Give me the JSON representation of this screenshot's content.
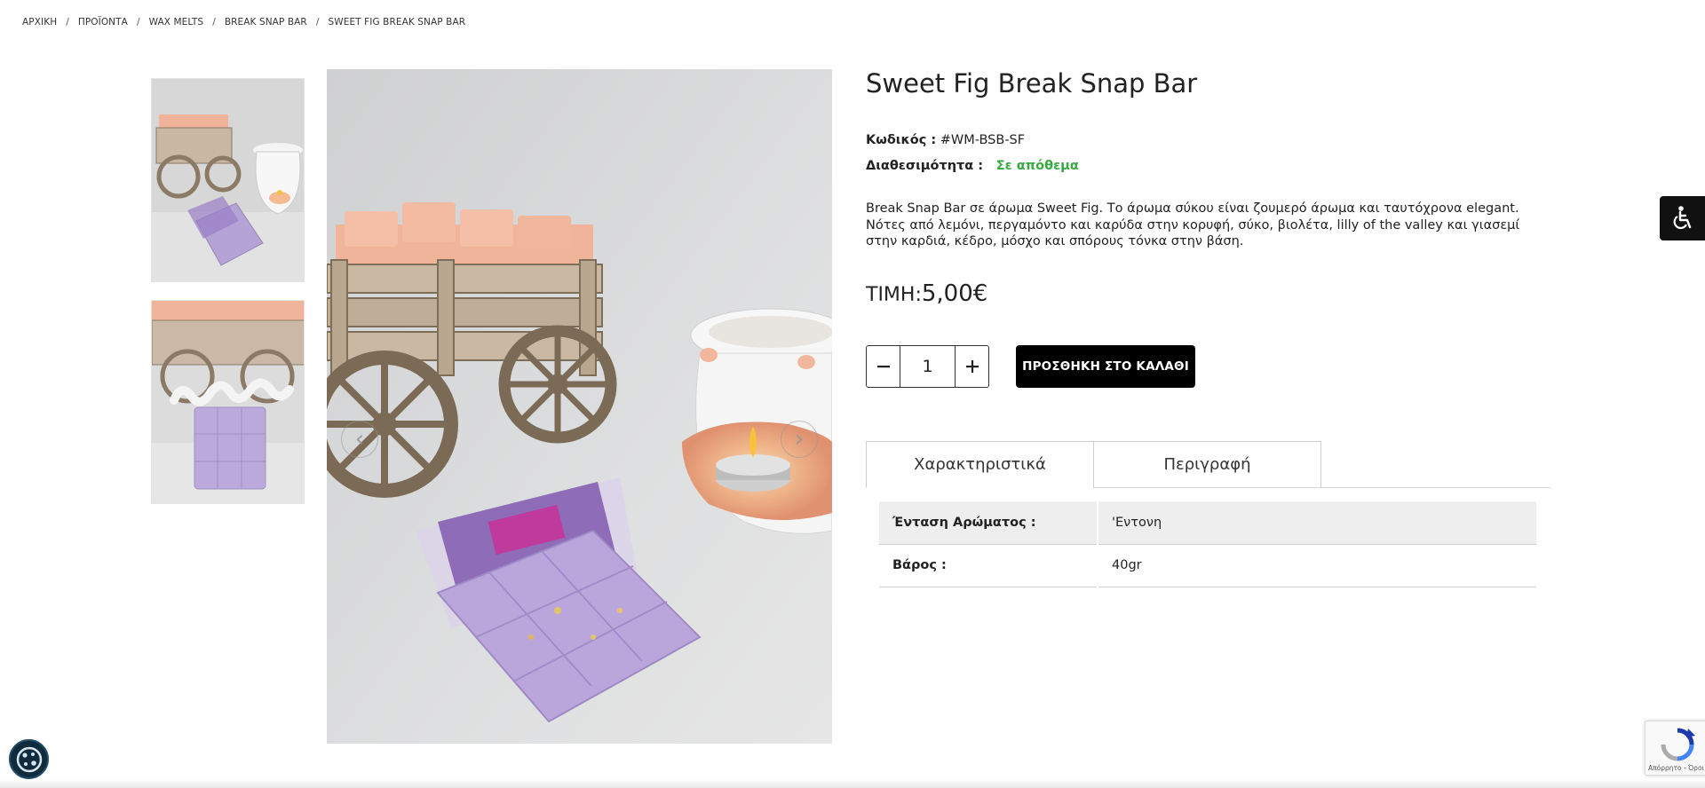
{
  "breadcrumb": {
    "items": [
      "ΑΡΧΙΚΗ",
      "ΠΡΟΪΟΝΤΑ",
      "WAX MELTS",
      "BREAK SNAP BAR",
      "SWEET FIG BREAK SNAP BAR"
    ],
    "separator": "/"
  },
  "product": {
    "title": "Sweet Fig Break Snap Bar",
    "code_label": "Κωδικός :",
    "code_value": "#WM-BSB-SF",
    "availability_label": "Διαθεσιμότητα :",
    "availability_value": "Σε απόθεμα",
    "description": "Break Snap Bar σε άρωμα Sweet Fig. Το άρωμα σύκου είναι ζουμερό άρωμα και ταυτόχρονα elegant. Νότες από λεμόνι, περγαμόντο και καρύδα στην κορυφή, σύκο, βιολέτα, lilly of the valley και γιασεμί στην καρδιά, κέδρο, μόσχο και σπόρους τόνκα στην βάση.",
    "price_label": "ΤΙΜΗ:",
    "price_value": "5,00€",
    "quantity": "1",
    "add_to_cart_label": "ΠΡΟΣΘΗΚΗ ΣΤΟ ΚΑΛΑΘΙ"
  },
  "tabs": [
    {
      "label": "Χαρακτηριστικά",
      "active": true
    },
    {
      "label": "Περιγραφή",
      "active": false
    }
  ],
  "attributes": [
    {
      "label": "Ένταση Αρώματος :",
      "value": "'Εντονη"
    },
    {
      "label": "Βάρος :",
      "value": "40gr"
    }
  ],
  "recaptcha": {
    "text": "Απόρρητο - Όροι"
  },
  "colors": {
    "in_stock": "#3aa845",
    "cart_button": "#000000",
    "wax_purple": "#b6a3d6",
    "wax_peach": "#f0b49a"
  },
  "icons": {
    "minus": "minus-icon",
    "plus": "plus-icon",
    "prev": "chevron-left-icon",
    "next": "chevron-right-icon",
    "accessibility": "wheelchair-icon",
    "cookie": "cookie-icon"
  }
}
